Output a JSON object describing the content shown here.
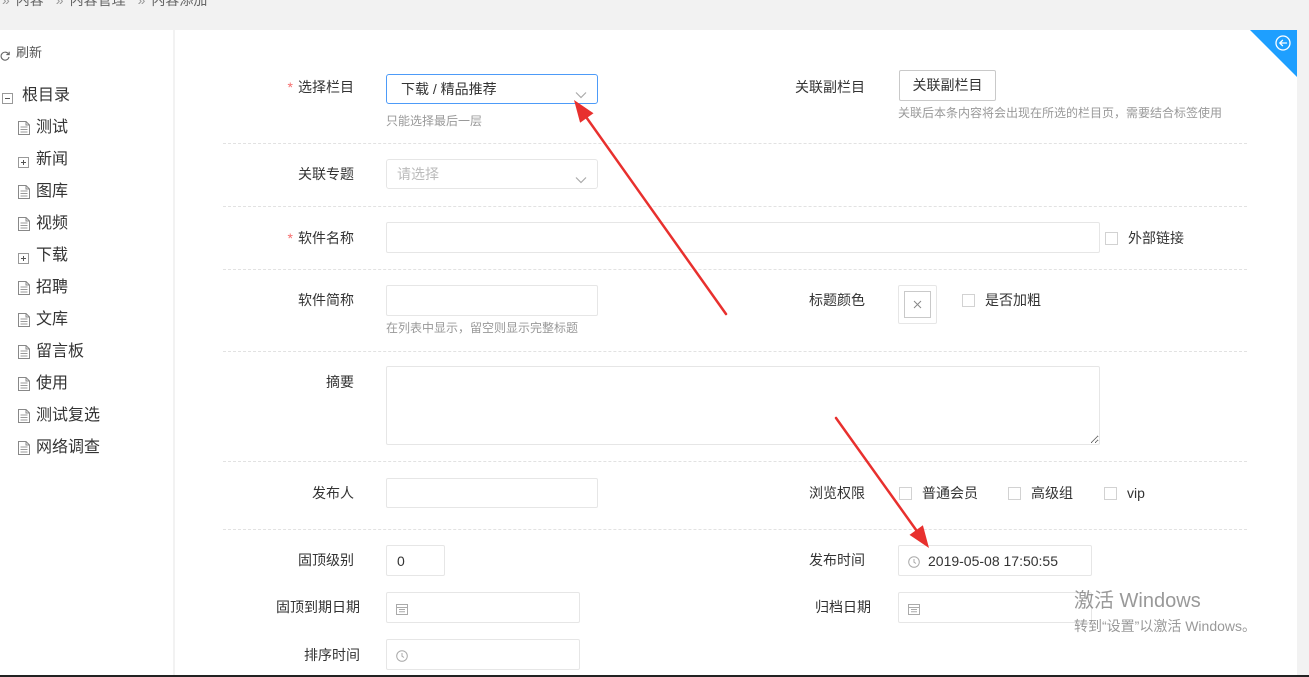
{
  "colors": {
    "accent": "#1E9FFF",
    "focus_border": "#4D9BF8",
    "required": "#F56C6C",
    "annotation_arrow": "#E8302E",
    "hint_text": "#999999"
  },
  "breadcrumb": [
    {
      "separator": "»",
      "label": "内容"
    },
    {
      "separator": "»",
      "label": "内容管理"
    },
    {
      "separator": "»",
      "label": "内容添加"
    }
  ],
  "sidebar": {
    "refresh_label": "刷新",
    "refresh_icon": "refresh-icon",
    "root": {
      "label": "根目录",
      "icon": "collapse-minus-icon"
    },
    "items": [
      {
        "label": "测试",
        "icon": "document-icon"
      },
      {
        "label": "新闻",
        "icon": "expand-plus-icon"
      },
      {
        "label": "图库",
        "icon": "document-icon"
      },
      {
        "label": "视频",
        "icon": "document-icon"
      },
      {
        "label": "下载",
        "icon": "expand-plus-icon"
      },
      {
        "label": "招聘",
        "icon": "document-icon"
      },
      {
        "label": "文库",
        "icon": "document-icon"
      },
      {
        "label": "留言板",
        "icon": "document-icon"
      },
      {
        "label": "使用",
        "icon": "document-icon"
      },
      {
        "label": "测试复选",
        "icon": "document-icon"
      },
      {
        "label": "网络调查",
        "icon": "document-icon"
      }
    ]
  },
  "form": {
    "required_mark": "*",
    "category": {
      "label": "选择栏目",
      "required": true,
      "value": "下载 / 精品推荐",
      "hint": "只能选择最后一层"
    },
    "sub_category": {
      "label": "关联副栏目",
      "button_label": "关联副栏目",
      "hint": "关联后本条内容将会出现在所选的栏目页，需要结合标签使用"
    },
    "topic": {
      "label": "关联专题",
      "placeholder": "请选择"
    },
    "software_name": {
      "label": "软件名称",
      "required": true,
      "value": "",
      "external_link_label": "外部链接",
      "external_link_checked": false
    },
    "short_name": {
      "label": "软件简称",
      "value": "",
      "hint": "在列表中显示，留空则显示完整标题"
    },
    "title_color": {
      "label": "标题颜色"
    },
    "bold": {
      "label": "是否加粗",
      "checked": false
    },
    "summary": {
      "label": "摘要",
      "value": ""
    },
    "publisher": {
      "label": "发布人",
      "value": ""
    },
    "view_permission": {
      "label": "浏览权限",
      "options": [
        {
          "label": "普通会员",
          "checked": false
        },
        {
          "label": "高级组",
          "checked": false
        },
        {
          "label": "vip",
          "checked": false
        }
      ]
    },
    "top_level": {
      "label": "固顶级别",
      "value": "0"
    },
    "publish_time": {
      "label": "发布时间",
      "value": "2019-05-08 17:50:55"
    },
    "top_expire_date": {
      "label": "固顶到期日期",
      "value": ""
    },
    "archive_date": {
      "label": "归档日期",
      "value": ""
    },
    "sort_time": {
      "label": "排序时间",
      "value": ""
    }
  },
  "watermark": {
    "title": "激活 Windows",
    "subtitle": "转到“设置”以激活 Windows。"
  }
}
